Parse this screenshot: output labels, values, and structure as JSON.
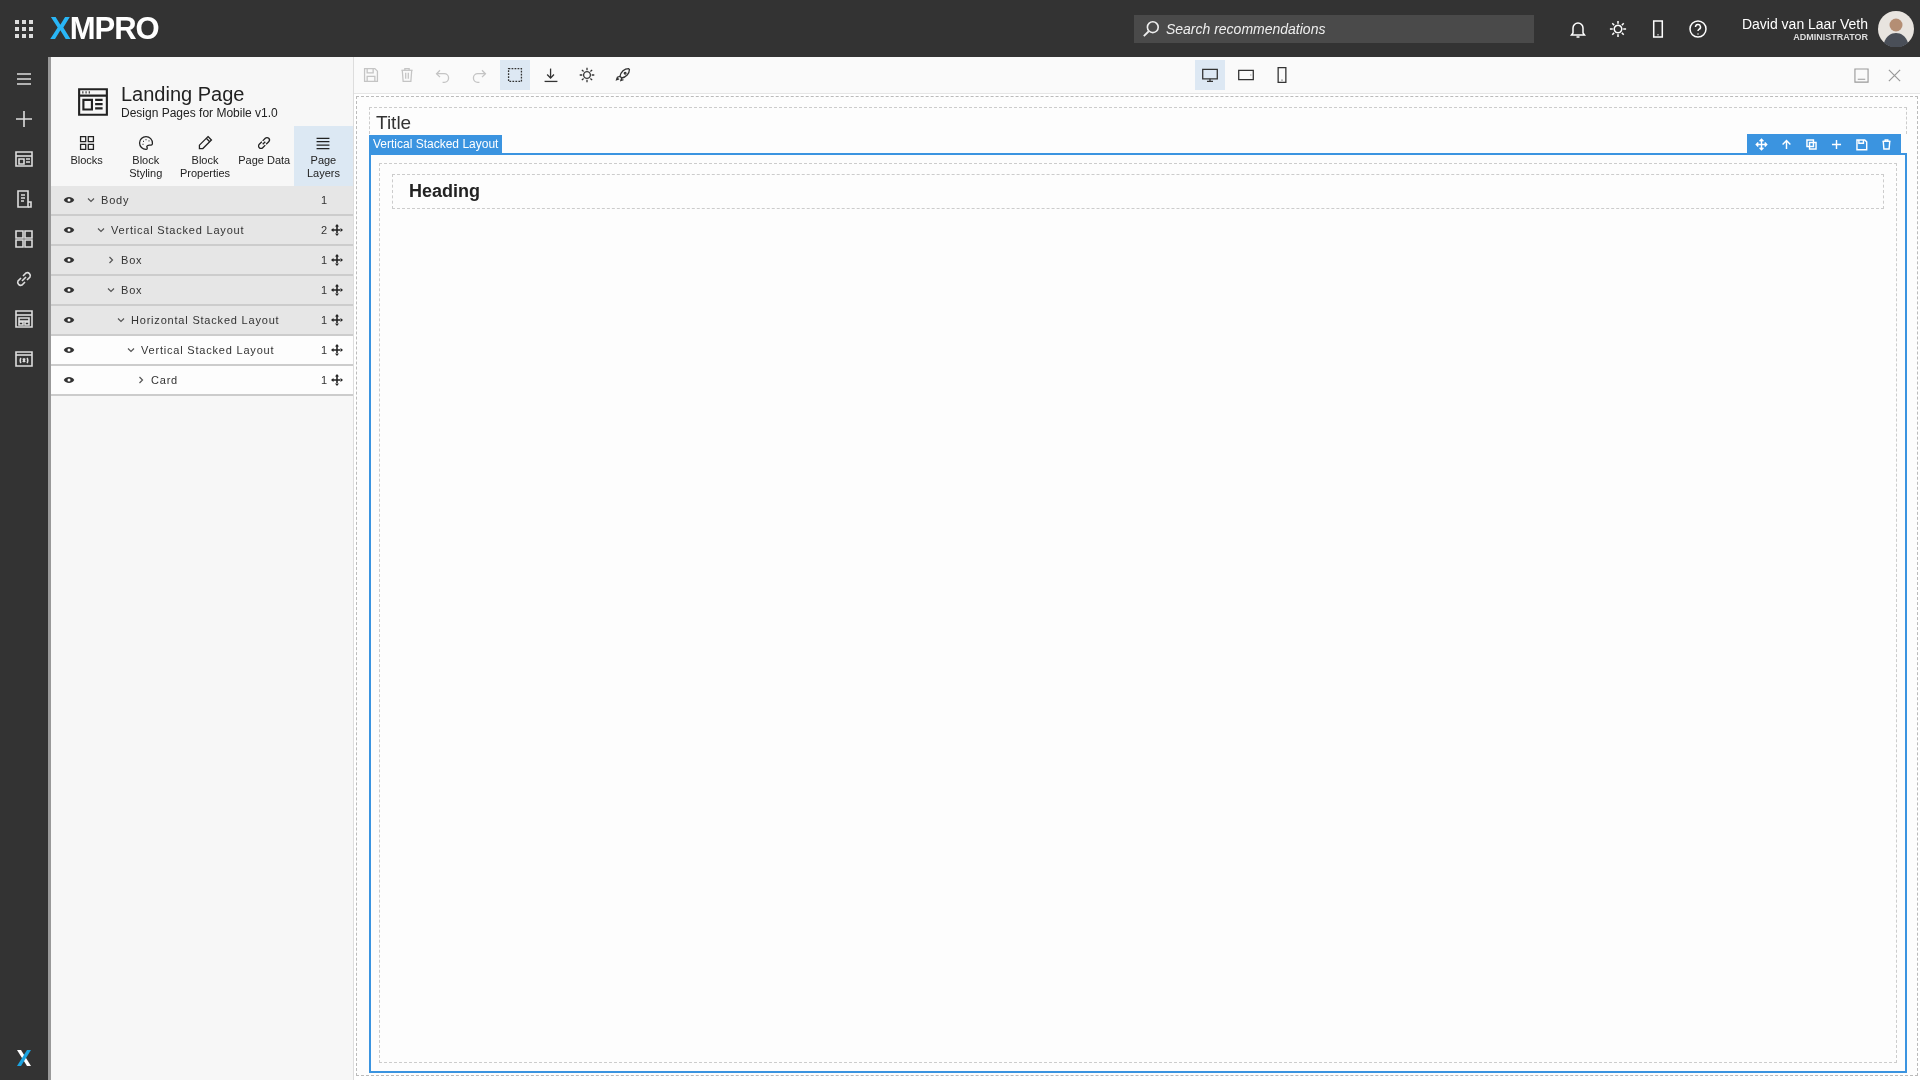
{
  "topbar": {
    "logo": "XMPRO",
    "search": {
      "placeholder": "Search recommendations"
    },
    "user": {
      "name": "David van Laar Veth",
      "role": "ADMINISTRATOR"
    }
  },
  "panel": {
    "title": "Landing Page",
    "subtitle": "Design Pages for Mobile v1.0",
    "tabs": [
      {
        "label": "Blocks",
        "kind": "blocks",
        "selected": false
      },
      {
        "label": "Block\nStyling",
        "kind": "styling",
        "selected": false
      },
      {
        "label": "Block\nProperties",
        "kind": "properties",
        "selected": false
      },
      {
        "label": "Page Data",
        "kind": "data",
        "selected": false
      },
      {
        "label": "Page\nLayers",
        "kind": "layers",
        "selected": true
      }
    ],
    "layers": [
      {
        "label": "Body",
        "count": "1",
        "expanded": true,
        "highlighted": true,
        "movable": false,
        "children": [
          {
            "label": "Vertical Stacked Layout",
            "count": "2",
            "expanded": true,
            "highlighted": true,
            "movable": true,
            "children": [
              {
                "label": "Box",
                "count": "1",
                "expanded": false,
                "highlighted": true,
                "movable": true
              },
              {
                "label": "Box",
                "count": "1",
                "expanded": true,
                "highlighted": true,
                "movable": true,
                "children": [
                  {
                    "label": "Horizontal Stacked Layout",
                    "count": "1",
                    "expanded": true,
                    "highlighted": true,
                    "movable": true,
                    "children": [
                      {
                        "label": "Vertical Stacked Layout",
                        "count": "1",
                        "expanded": true,
                        "highlighted": false,
                        "movable": true,
                        "children": [
                          {
                            "label": "Card",
                            "count": "1",
                            "expanded": false,
                            "highlighted": false,
                            "movable": true
                          }
                        ]
                      }
                    ]
                  }
                ]
              }
            ]
          }
        ]
      }
    ]
  },
  "toolbar": {
    "tools": [
      {
        "kind": "save",
        "disabled": true,
        "selected": false
      },
      {
        "kind": "delete",
        "disabled": true,
        "selected": false
      },
      {
        "kind": "undo",
        "disabled": true,
        "selected": false
      },
      {
        "kind": "redo",
        "disabled": true,
        "selected": false
      },
      {
        "kind": "select",
        "disabled": false,
        "selected": true
      },
      {
        "kind": "download",
        "disabled": false,
        "selected": false
      },
      {
        "kind": "settings",
        "disabled": false,
        "selected": false
      },
      {
        "kind": "publish",
        "disabled": false,
        "selected": false
      }
    ],
    "devices": [
      {
        "kind": "desktop",
        "selected": true
      },
      {
        "kind": "tablet",
        "selected": false
      },
      {
        "kind": "phone",
        "selected": false
      }
    ]
  },
  "canvas": {
    "title": "Title",
    "selection_label": "Vertical Stacked Layout",
    "heading": "Heading"
  }
}
